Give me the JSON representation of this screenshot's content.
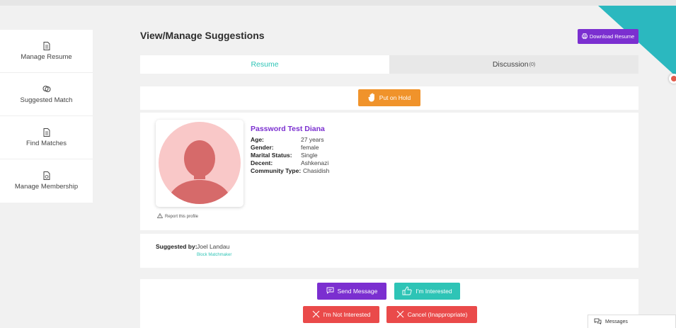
{
  "colors": {
    "accent_purple": "#7b2fd0",
    "accent_teal": "#2ec4b6",
    "hold_orange": "#f0932b",
    "danger_red": "#ea4a4a"
  },
  "sidebar": {
    "items": [
      {
        "label": "Manage Resume",
        "icon": "document-icon"
      },
      {
        "label": "Suggested Match",
        "icon": "hearts-icon"
      },
      {
        "label": "Find Matches",
        "icon": "document-icon"
      },
      {
        "label": "Manage Membership",
        "icon": "membership-doc-icon"
      }
    ]
  },
  "header": {
    "title": "View/Manage Suggestions",
    "download_label": "Download Resume"
  },
  "tabs": [
    {
      "label": "Resume",
      "active": true
    },
    {
      "label": "Discussion",
      "count": "(0)",
      "active": false
    }
  ],
  "hold_label": "Put on Hold",
  "profile": {
    "name": "Password Test Diana",
    "report_label": "Report this profile",
    "details": [
      {
        "key": "Age:",
        "value": "27 years"
      },
      {
        "key": "Gender:",
        "value": "female"
      },
      {
        "key": "Marital Status:",
        "value": "Single"
      },
      {
        "key": "Decent:",
        "value": "Ashkenazi"
      },
      {
        "key": "Community Type:",
        "value": "Chasidish"
      }
    ]
  },
  "suggestion": {
    "label": "Suggested by:",
    "name": "Joel Landau",
    "block_label": "Block Matchmaker"
  },
  "actions": {
    "send_message": "Send Message",
    "interested": "I'm Interested",
    "not_interested": "I'm Not Interested",
    "cancel": "Cancel (Inappropriate)"
  },
  "messages_label": "Messages"
}
